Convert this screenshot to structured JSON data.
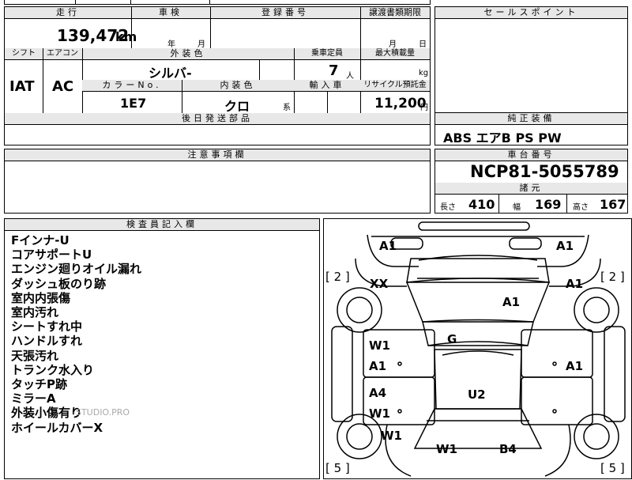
{
  "top_row": {
    "mileage_header": "走行",
    "mileage_value": "139,472",
    "mileage_unit": "km",
    "inspection_header": "車検",
    "inspection_year": "年",
    "inspection_month": "月",
    "registration_header": "登録番号",
    "transfer_header": "譲渡書類期限",
    "transfer_month": "月",
    "transfer_day": "日",
    "sales_point_header": "セールスポイント"
  },
  "spec_row": {
    "shift_header": "シフト",
    "shift_value": "IAT",
    "ac_header": "エアコン",
    "ac_value": "AC",
    "exterior_header": "外装色",
    "exterior_value": "シルバ-",
    "capacity_header": "乗車定員",
    "capacity_value": "7",
    "capacity_unit": "人",
    "max_load_header": "最大積載量",
    "max_load_unit": "kg",
    "color_no_header": "カラーNo.",
    "color_no_value": "1E7",
    "interior_header": "内装色",
    "interior_value": "クロ",
    "interior_unit": "系",
    "import_header": "輸入車",
    "recycle_header": "リサイクル預託金",
    "recycle_value": "11,200",
    "recycle_unit": "円",
    "parts_header": "後日発送部品"
  },
  "equipment": {
    "header": "純正装備",
    "value": "ABS エアB PS PW"
  },
  "caution_header": "注意事項欄",
  "chassis": {
    "header": "車台番号",
    "value": "NCP81-5055789",
    "dims_header": "諸元",
    "length_label": "長さ",
    "length_value": "410",
    "width_label": "幅",
    "width_value": "169",
    "height_label": "高さ",
    "height_value": "167"
  },
  "inspector": {
    "header": "検査員記入欄",
    "notes": [
      "Fインナ-U",
      "コアサポートU",
      "エンジン廻りオイル漏れ",
      "ダッシュ板のり跡",
      "室内内張傷",
      "室内汚れ",
      "シートすれ中",
      "ハンドルすれ",
      "天張汚れ",
      "トランク水入り",
      "タッチP跡",
      "ミラーA",
      "外装小傷有り",
      "ホイールカバーX"
    ]
  },
  "watermark": "-STUDIO.PRO",
  "diagram": {
    "marks": {
      "front_left": "A1",
      "front_right": "A1",
      "fender_left": "XX",
      "fender_right": "A1",
      "hood": "A1",
      "roof": "G",
      "door_fl_upper": "W1",
      "door_fl_lower": "A1",
      "door_fr": "A1",
      "door_rl_upper": "A4",
      "door_rl_lower": "W1",
      "rear_roof": "U2",
      "quarter_left": "W1",
      "rear_left": "W1",
      "rear_right": "B4"
    },
    "tire_left_front": "[ 2 ]",
    "tire_right_front": "[ 2 ]",
    "tire_left_rear": "[ 5 ]",
    "tire_right_rear": "[ 5 ]"
  }
}
